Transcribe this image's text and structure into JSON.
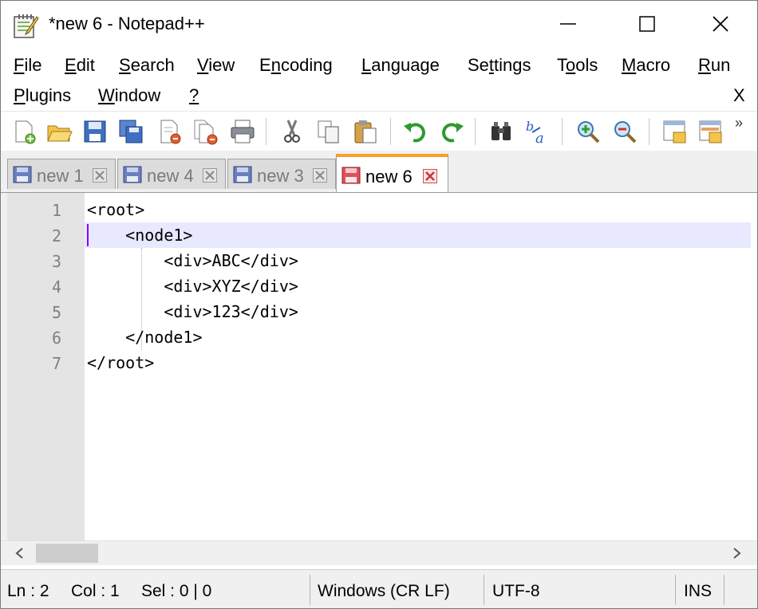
{
  "window": {
    "title": "*new 6 - Notepad++",
    "icon": "notepad-icon"
  },
  "menu": {
    "row1": [
      {
        "pre": "",
        "u": "F",
        "post": "ile"
      },
      {
        "pre": "",
        "u": "E",
        "post": "dit"
      },
      {
        "pre": "",
        "u": "S",
        "post": "earch"
      },
      {
        "pre": "",
        "u": "V",
        "post": "iew"
      },
      {
        "pre": "E",
        "u": "n",
        "post": "coding"
      },
      {
        "pre": "",
        "u": "L",
        "post": "anguage"
      },
      {
        "pre": "Se",
        "u": "t",
        "post": "tings"
      },
      {
        "pre": "T",
        "u": "o",
        "post": "ols"
      },
      {
        "pre": "",
        "u": "M",
        "post": "acro"
      },
      {
        "pre": "",
        "u": "R",
        "post": "un"
      }
    ],
    "row2": [
      {
        "pre": "",
        "u": "P",
        "post": "lugins"
      },
      {
        "pre": "",
        "u": "W",
        "post": "indow"
      },
      {
        "pre": "",
        "u": "?",
        "post": ""
      }
    ],
    "close_doc": "X"
  },
  "toolbar": {
    "icons": [
      "new-file-icon",
      "open-file-icon",
      "save-icon",
      "save-all-icon",
      "close-icon",
      "close-all-icon",
      "print-icon",
      "cut-icon",
      "copy-icon",
      "paste-icon",
      "undo-icon",
      "redo-icon",
      "find-icon",
      "replace-icon",
      "zoom-in-icon",
      "zoom-out-icon",
      "sync-vertical-icon",
      "sync-horizontal-icon"
    ],
    "more": "»"
  },
  "tabs": [
    {
      "label": "new 1",
      "active": false
    },
    {
      "label": "new 4",
      "active": false
    },
    {
      "label": "new 3",
      "active": false
    },
    {
      "label": "new 6",
      "active": true
    }
  ],
  "editor": {
    "line_numbers": [
      "1",
      "2",
      "3",
      "4",
      "5",
      "6",
      "7"
    ],
    "lines": [
      "<root>",
      "    <node1>",
      "        <div>ABC</div>",
      "        <div>XYZ</div>",
      "        <div>123</div>",
      "    </node1>",
      "</root>"
    ],
    "current_line": 2
  },
  "status": {
    "ln": "Ln : 2",
    "col": "Col : 1",
    "sel": "Sel : 0 | 0",
    "eol": "Windows (CR LF)",
    "encoding": "UTF-8",
    "mode": "INS"
  },
  "colors": {
    "active_tab_accent": "#f4a02c",
    "current_line_bg": "#e8e8ff",
    "caret": "#8000ff",
    "gutter_bg": "#e4e4e4"
  }
}
